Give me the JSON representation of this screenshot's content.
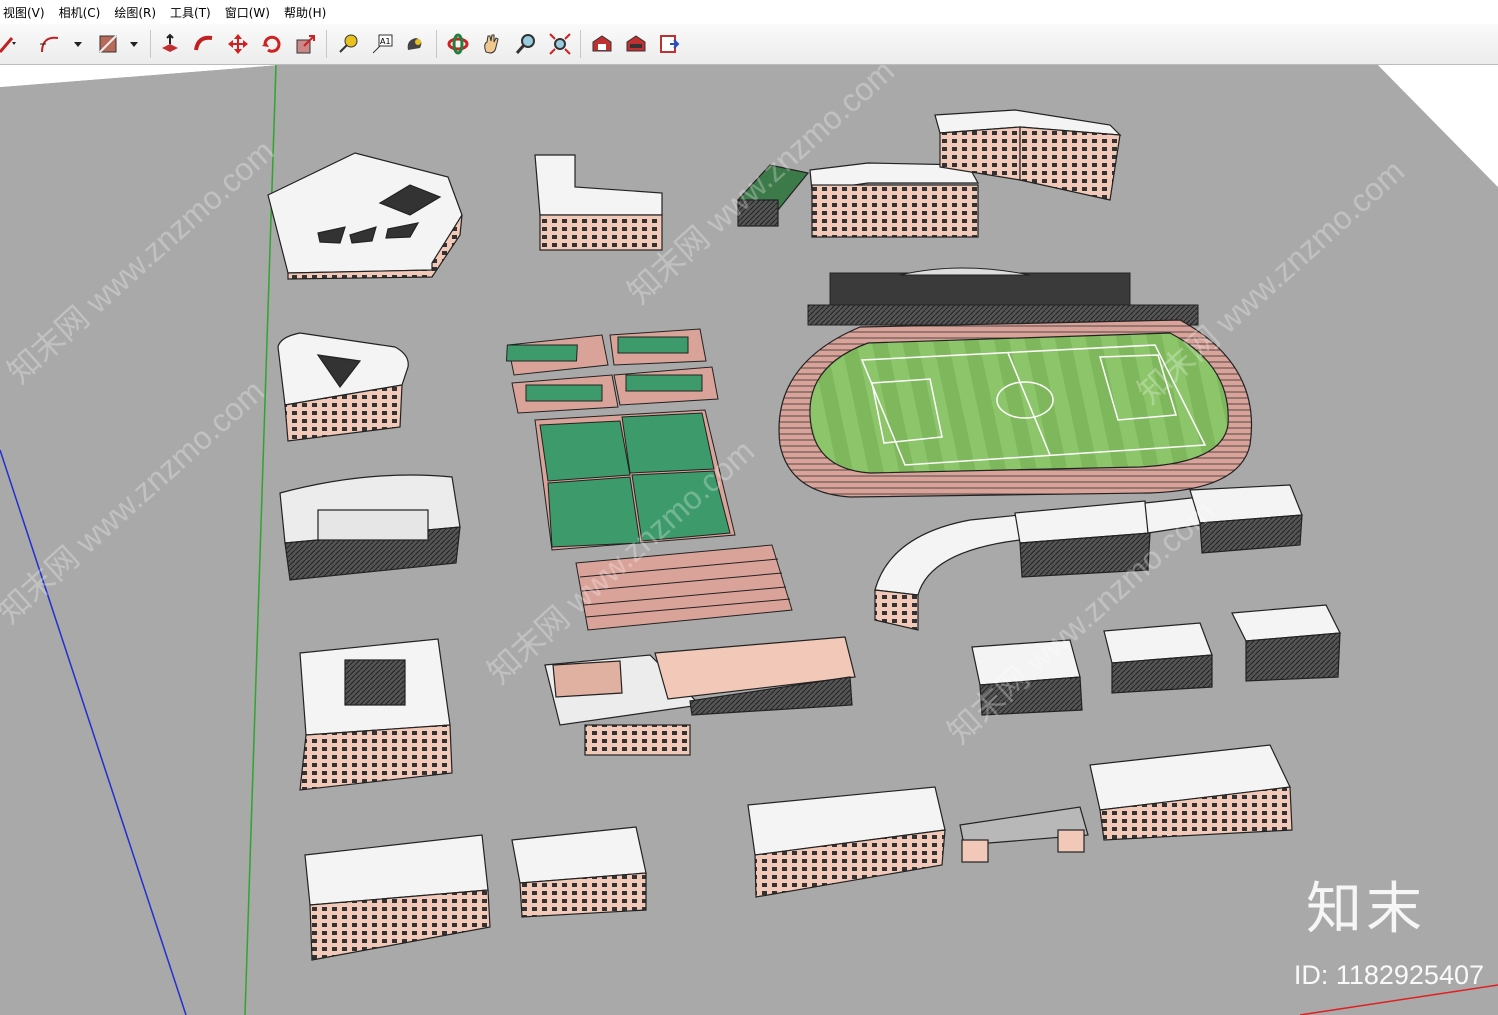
{
  "menu": {
    "items": [
      "视图(V)",
      "相机(C)",
      "绘图(R)",
      "工具(T)",
      "窗口(W)",
      "帮助(H)"
    ]
  },
  "toolbar": {
    "icons": [
      "pencil-dropdown-icon",
      "arc-tool-icon",
      "paint-bucket-icon",
      "push-pull-icon",
      "follow-me-icon",
      "move-icon",
      "rotate-icon",
      "scale-icon",
      "tape-measure-icon",
      "text-label-icon",
      "paint-icon",
      "orbit-icon",
      "pan-icon",
      "zoom-icon",
      "zoom-extents-icon",
      "warehouse-icon",
      "extension-icon",
      "export-icon"
    ],
    "text_tool_label": "A1"
  },
  "scene": {
    "ground_color": "#a9a9a9",
    "sky_color": "#ffffff",
    "axis_colors": {
      "green": "#2fa52f",
      "blue": "#2030d0",
      "red": "#e02020"
    },
    "building_wall_color": "#f2c9b8",
    "roof_color": "#f4f4f4",
    "field_color": "#8dc66a",
    "court_color": "#3d9a6a"
  },
  "watermark": {
    "logo": "知末",
    "id_text": "ID: 1182925407",
    "repeat_text": "知末网 www.znzmo.com"
  }
}
